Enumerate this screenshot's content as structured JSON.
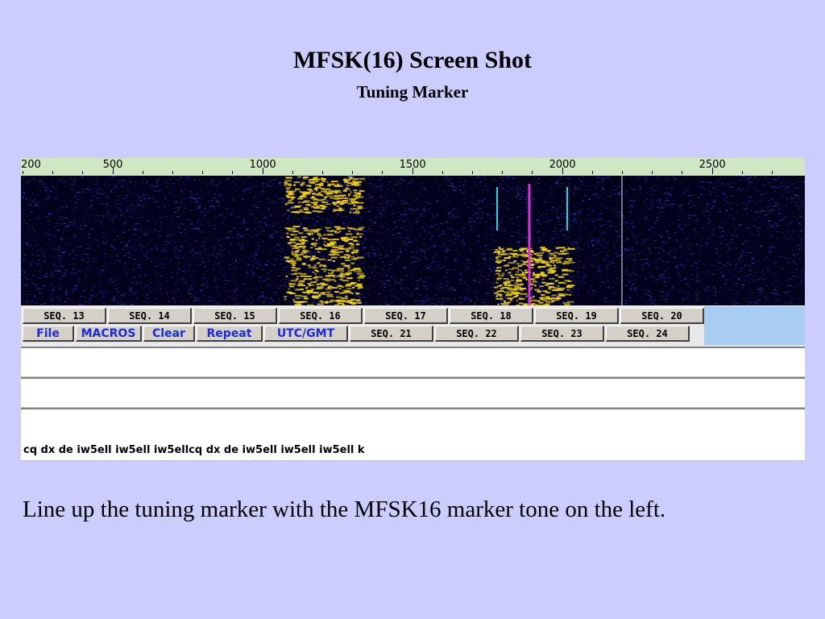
{
  "slide": {
    "title": "MFSK(16) Screen Shot",
    "subtitle": "Tuning Marker",
    "caption": "Line up the tuning marker with the MFSK16 marker tone on the left."
  },
  "ruler": {
    "labels": [
      {
        "text": "200",
        "hz": 200
      },
      {
        "text": "500",
        "hz": 500
      },
      {
        "text": "1000",
        "hz": 1000
      },
      {
        "text": "1500",
        "hz": 1500
      },
      {
        "text": "2000",
        "hz": 2000
      },
      {
        "text": "2500",
        "hz": 2500
      }
    ]
  },
  "waterfall": {
    "colors": {
      "background": "#02021c",
      "noise": "#3a3ad8",
      "signal": "#f0d020",
      "marker_cyan": "#20d8e0",
      "marker_magenta": "#e030e0",
      "marker_white": "#e8e8e8"
    }
  },
  "buttons": {
    "row1": [
      "SEQ. 13",
      "SEQ. 14",
      "SEQ. 15",
      "SEQ. 16",
      "SEQ. 17",
      "SEQ. 18",
      "SEQ. 19",
      "SEQ. 20"
    ],
    "row2": [
      "File",
      "MACROS",
      "Clear",
      "Repeat",
      "UTC/GMT",
      "SEQ. 21",
      "SEQ. 22",
      "SEQ. 23",
      "SEQ. 24"
    ]
  },
  "rx_text": "cq dx de iw5ell iw5ell iw5ellcq dx de iw5ell iw5ell iw5ell k"
}
